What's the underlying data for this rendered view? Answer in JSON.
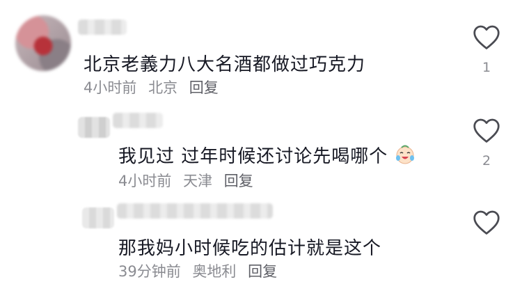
{
  "comments": [
    {
      "text": "北京老義力八大名酒都做过巧克力",
      "time": "4小时前",
      "location": "北京",
      "reply_label": "回复",
      "likes": "1",
      "icons": {
        "avatar": "avatar",
        "like": "heart-outline-icon"
      }
    },
    {
      "text": "我见过 过年时候还讨论先喝哪个",
      "emoji": "laughing-crying-face-icon",
      "time": "4小时前",
      "location": "天津",
      "reply_label": "回复",
      "likes": "2",
      "icons": {
        "avatar": "avatar",
        "like": "heart-outline-icon"
      }
    },
    {
      "text": "那我妈小时候吃的估计就是这个",
      "time": "39分钟前",
      "location": "奥地利",
      "reply_label": "回复",
      "likes": "",
      "icons": {
        "avatar": "avatar",
        "like": "heart-outline-icon"
      }
    }
  ],
  "colors": {
    "text": "#161823",
    "meta": "#8a8b91",
    "heart_stroke": "#4a4b52"
  }
}
